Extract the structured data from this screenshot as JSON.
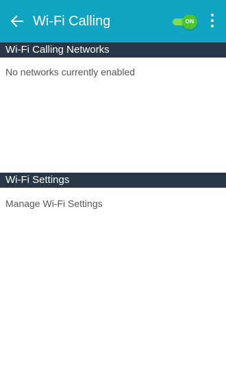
{
  "app_bar": {
    "title": "Wi-Fi Calling",
    "back_icon": "arrow-left-icon",
    "toggle_label": "ON",
    "toggle_state": "on",
    "overflow_icon": "more-vertical-icon",
    "colors": {
      "bar": "#0fa5c2",
      "toggle": "#4cc62d"
    }
  },
  "networks_section": {
    "header": "Wi-Fi Calling Networks",
    "empty_message": "No networks currently enabled"
  },
  "settings_section": {
    "header": "Wi-Fi Settings",
    "items": [
      {
        "label": "Manage Wi-Fi Settings"
      }
    ]
  },
  "colors": {
    "section_header_bg": "#283747",
    "body_text": "#555555"
  }
}
